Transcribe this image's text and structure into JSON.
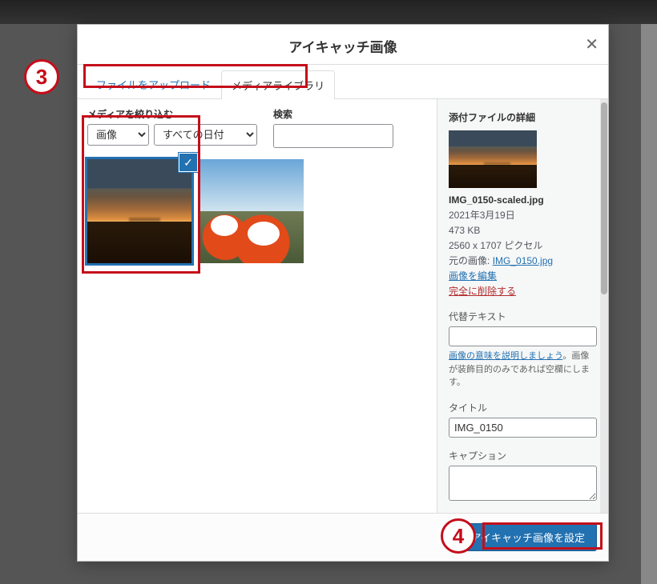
{
  "modal": {
    "title": "アイキャッチ画像",
    "close_glyph": "✕"
  },
  "tabs": {
    "upload": "ファイルをアップロード",
    "library": "メディアライブラリ"
  },
  "filters": {
    "label": "メディアを絞り込む",
    "type_option": "画像",
    "date_option": "すべての日付",
    "search_label": "検索"
  },
  "details": {
    "heading": "添付ファイルの詳細",
    "filename": "IMG_0150-scaled.jpg",
    "date": "2021年3月19日",
    "filesize": "473 KB",
    "dimensions": "2560 x 1707 ピクセル",
    "original_label": "元の画像:",
    "original_link": "IMG_0150.jpg",
    "edit_link": "画像を編集",
    "delete_link": "完全に削除する",
    "alt_label": "代替テキスト",
    "alt_value": "",
    "alt_hint_link": "画像の意味を説明しましょう",
    "alt_hint_rest": "。画像が装飾目的のみであれば空欄にします。",
    "title_label": "タイトル",
    "title_value": "IMG_0150",
    "caption_label": "キャプション",
    "caption_value": ""
  },
  "footer": {
    "set_button": "アイキャッチ画像を設定"
  },
  "annotations": {
    "n3": "3",
    "n4": "4"
  },
  "icons": {
    "check": "✓",
    "dropdown": "▾"
  }
}
